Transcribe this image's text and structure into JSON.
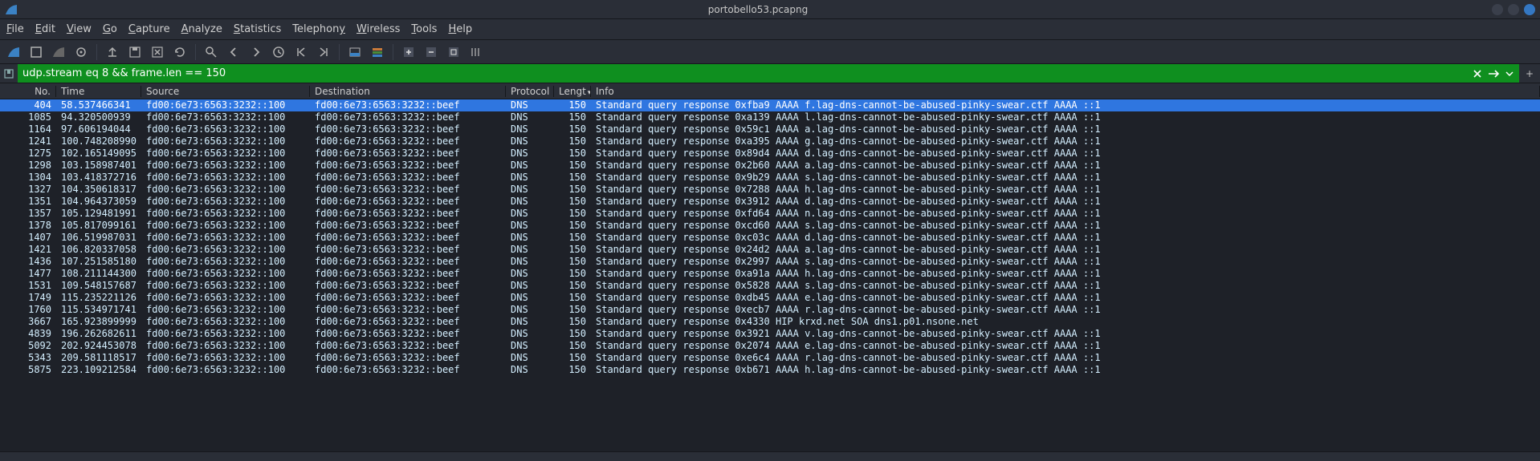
{
  "window": {
    "title": "portobello53.pcapng"
  },
  "menu": {
    "file": "File",
    "edit": "Edit",
    "view": "View",
    "go": "Go",
    "capture": "Capture",
    "analyze": "Analyze",
    "statistics": "Statistics",
    "telephony": "Telephony",
    "wireless": "Wireless",
    "tools": "Tools",
    "help": "Help"
  },
  "filter": {
    "value": "udp.stream eq 8 && frame.len == 150"
  },
  "columns": {
    "no": "No.",
    "time": "Time",
    "source": "Source",
    "destination": "Destination",
    "protocol": "Protocol",
    "length": "Lengt",
    "info": "Info"
  },
  "packets": [
    {
      "no": "404",
      "time": "58.537466341",
      "src": "fd00:6e73:6563:3232::100",
      "dst": "fd00:6e73:6563:3232::beef",
      "proto": "DNS",
      "len": "150",
      "info": "Standard query response 0xfba9 AAAA f.lag-dns-cannot-be-abused-pinky-swear.ctf AAAA ::1",
      "sel": true
    },
    {
      "no": "1085",
      "time": "94.320500939",
      "src": "fd00:6e73:6563:3232::100",
      "dst": "fd00:6e73:6563:3232::beef",
      "proto": "DNS",
      "len": "150",
      "info": "Standard query response 0xa139 AAAA l.lag-dns-cannot-be-abused-pinky-swear.ctf AAAA ::1"
    },
    {
      "no": "1164",
      "time": "97.606194044",
      "src": "fd00:6e73:6563:3232::100",
      "dst": "fd00:6e73:6563:3232::beef",
      "proto": "DNS",
      "len": "150",
      "info": "Standard query response 0x59c1 AAAA a.lag-dns-cannot-be-abused-pinky-swear.ctf AAAA ::1"
    },
    {
      "no": "1241",
      "time": "100.748208990",
      "src": "fd00:6e73:6563:3232::100",
      "dst": "fd00:6e73:6563:3232::beef",
      "proto": "DNS",
      "len": "150",
      "info": "Standard query response 0xa395 AAAA g.lag-dns-cannot-be-abused-pinky-swear.ctf AAAA ::1"
    },
    {
      "no": "1275",
      "time": "102.165149095",
      "src": "fd00:6e73:6563:3232::100",
      "dst": "fd00:6e73:6563:3232::beef",
      "proto": "DNS",
      "len": "150",
      "info": "Standard query response 0x89d4 AAAA d.lag-dns-cannot-be-abused-pinky-swear.ctf AAAA ::1"
    },
    {
      "no": "1298",
      "time": "103.158987401",
      "src": "fd00:6e73:6563:3232::100",
      "dst": "fd00:6e73:6563:3232::beef",
      "proto": "DNS",
      "len": "150",
      "info": "Standard query response 0x2b60 AAAA a.lag-dns-cannot-be-abused-pinky-swear.ctf AAAA ::1"
    },
    {
      "no": "1304",
      "time": "103.418372716",
      "src": "fd00:6e73:6563:3232::100",
      "dst": "fd00:6e73:6563:3232::beef",
      "proto": "DNS",
      "len": "150",
      "info": "Standard query response 0x9b29 AAAA s.lag-dns-cannot-be-abused-pinky-swear.ctf AAAA ::1"
    },
    {
      "no": "1327",
      "time": "104.350618317",
      "src": "fd00:6e73:6563:3232::100",
      "dst": "fd00:6e73:6563:3232::beef",
      "proto": "DNS",
      "len": "150",
      "info": "Standard query response 0x7288 AAAA h.lag-dns-cannot-be-abused-pinky-swear.ctf AAAA ::1"
    },
    {
      "no": "1351",
      "time": "104.964373059",
      "src": "fd00:6e73:6563:3232::100",
      "dst": "fd00:6e73:6563:3232::beef",
      "proto": "DNS",
      "len": "150",
      "info": "Standard query response 0x3912 AAAA d.lag-dns-cannot-be-abused-pinky-swear.ctf AAAA ::1"
    },
    {
      "no": "1357",
      "time": "105.129481991",
      "src": "fd00:6e73:6563:3232::100",
      "dst": "fd00:6e73:6563:3232::beef",
      "proto": "DNS",
      "len": "150",
      "info": "Standard query response 0xfd64 AAAA n.lag-dns-cannot-be-abused-pinky-swear.ctf AAAA ::1"
    },
    {
      "no": "1378",
      "time": "105.817099161",
      "src": "fd00:6e73:6563:3232::100",
      "dst": "fd00:6e73:6563:3232::beef",
      "proto": "DNS",
      "len": "150",
      "info": "Standard query response 0xcd60 AAAA s.lag-dns-cannot-be-abused-pinky-swear.ctf AAAA ::1"
    },
    {
      "no": "1407",
      "time": "106.519987031",
      "src": "fd00:6e73:6563:3232::100",
      "dst": "fd00:6e73:6563:3232::beef",
      "proto": "DNS",
      "len": "150",
      "info": "Standard query response 0xc03c AAAA d.lag-dns-cannot-be-abused-pinky-swear.ctf AAAA ::1"
    },
    {
      "no": "1421",
      "time": "106.820337058",
      "src": "fd00:6e73:6563:3232::100",
      "dst": "fd00:6e73:6563:3232::beef",
      "proto": "DNS",
      "len": "150",
      "info": "Standard query response 0x24d2 AAAA a.lag-dns-cannot-be-abused-pinky-swear.ctf AAAA ::1"
    },
    {
      "no": "1436",
      "time": "107.251585180",
      "src": "fd00:6e73:6563:3232::100",
      "dst": "fd00:6e73:6563:3232::beef",
      "proto": "DNS",
      "len": "150",
      "info": "Standard query response 0x2997 AAAA s.lag-dns-cannot-be-abused-pinky-swear.ctf AAAA ::1"
    },
    {
      "no": "1477",
      "time": "108.211144300",
      "src": "fd00:6e73:6563:3232::100",
      "dst": "fd00:6e73:6563:3232::beef",
      "proto": "DNS",
      "len": "150",
      "info": "Standard query response 0xa91a AAAA h.lag-dns-cannot-be-abused-pinky-swear.ctf AAAA ::1"
    },
    {
      "no": "1531",
      "time": "109.548157687",
      "src": "fd00:6e73:6563:3232::100",
      "dst": "fd00:6e73:6563:3232::beef",
      "proto": "DNS",
      "len": "150",
      "info": "Standard query response 0x5828 AAAA s.lag-dns-cannot-be-abused-pinky-swear.ctf AAAA ::1"
    },
    {
      "no": "1749",
      "time": "115.235221126",
      "src": "fd00:6e73:6563:3232::100",
      "dst": "fd00:6e73:6563:3232::beef",
      "proto": "DNS",
      "len": "150",
      "info": "Standard query response 0xdb45 AAAA e.lag-dns-cannot-be-abused-pinky-swear.ctf AAAA ::1"
    },
    {
      "no": "1760",
      "time": "115.534971741",
      "src": "fd00:6e73:6563:3232::100",
      "dst": "fd00:6e73:6563:3232::beef",
      "proto": "DNS",
      "len": "150",
      "info": "Standard query response 0xecb7 AAAA r.lag-dns-cannot-be-abused-pinky-swear.ctf AAAA ::1"
    },
    {
      "no": "3667",
      "time": "165.923899999",
      "src": "fd00:6e73:6563:3232::100",
      "dst": "fd00:6e73:6563:3232::beef",
      "proto": "DNS",
      "len": "150",
      "info": "Standard query response 0x4330 HIP krxd.net SOA dns1.p01.nsone.net"
    },
    {
      "no": "4839",
      "time": "196.262682611",
      "src": "fd00:6e73:6563:3232::100",
      "dst": "fd00:6e73:6563:3232::beef",
      "proto": "DNS",
      "len": "150",
      "info": "Standard query response 0x3921 AAAA v.lag-dns-cannot-be-abused-pinky-swear.ctf AAAA ::1"
    },
    {
      "no": "5092",
      "time": "202.924453078",
      "src": "fd00:6e73:6563:3232::100",
      "dst": "fd00:6e73:6563:3232::beef",
      "proto": "DNS",
      "len": "150",
      "info": "Standard query response 0x2074 AAAA e.lag-dns-cannot-be-abused-pinky-swear.ctf AAAA ::1"
    },
    {
      "no": "5343",
      "time": "209.581118517",
      "src": "fd00:6e73:6563:3232::100",
      "dst": "fd00:6e73:6563:3232::beef",
      "proto": "DNS",
      "len": "150",
      "info": "Standard query response 0xe6c4 AAAA r.lag-dns-cannot-be-abused-pinky-swear.ctf AAAA ::1"
    },
    {
      "no": "5875",
      "time": "223.109212584",
      "src": "fd00:6e73:6563:3232::100",
      "dst": "fd00:6e73:6563:3232::beef",
      "proto": "DNS",
      "len": "150",
      "info": "Standard query response 0xb671 AAAA h.lag-dns-cannot-be-abused-pinky-swear.ctf AAAA ::1"
    }
  ]
}
